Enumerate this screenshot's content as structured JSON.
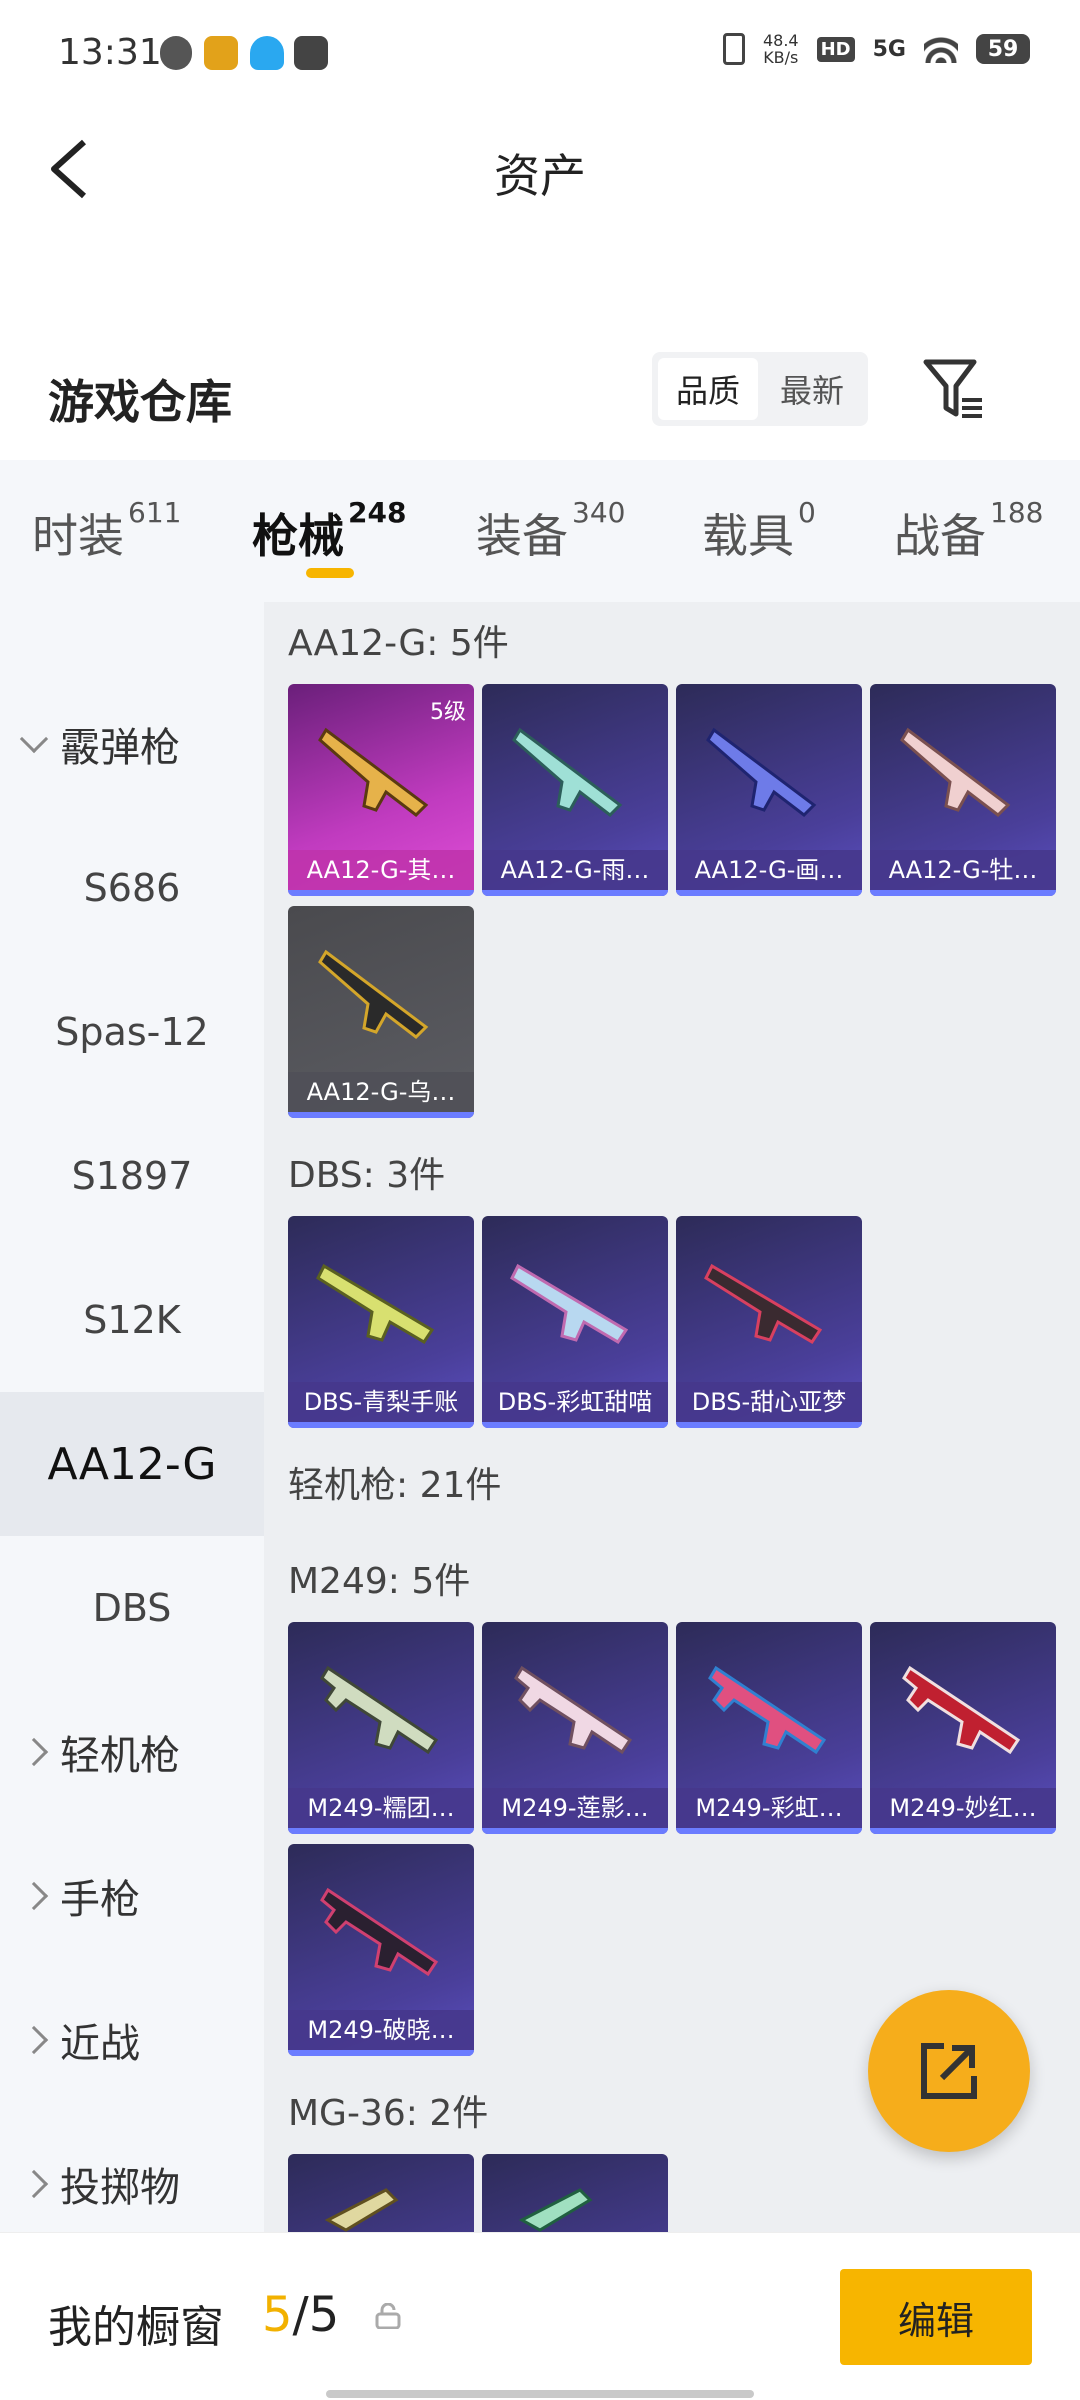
{
  "status_bar": {
    "time": "13:31",
    "net_speed_top": "48.4",
    "net_speed_unit": "KB/s",
    "hd": "HD",
    "network": "5G",
    "battery": "59"
  },
  "header": {
    "title": "资产"
  },
  "warehouse": {
    "title": "游戏仓库",
    "sort_quality": "品质",
    "sort_newest": "最新"
  },
  "tabs": [
    {
      "label": "时装",
      "count": "611"
    },
    {
      "label": "枪械",
      "count": "248"
    },
    {
      "label": "装备",
      "count": "340"
    },
    {
      "label": "载具",
      "count": "0"
    },
    {
      "label": "战备",
      "count": "188"
    }
  ],
  "sidebar": {
    "group_shotgun": "霰弹枪",
    "items": [
      "S686",
      "Spas-12",
      "S1897",
      "S12K",
      "AA12-G",
      "DBS"
    ],
    "selected": "AA12-G",
    "group_lmg": "轻机枪",
    "group_pistol": "手枪",
    "group_melee": "近战",
    "group_throw": "投掷物"
  },
  "sections": {
    "aa12": "AA12-G: 5件",
    "dbs": "DBS: 3件",
    "lmg": "轻机枪: 21件",
    "m249": "M249: 5件",
    "mg36": "MG-36: 2件"
  },
  "cards": {
    "aa12": [
      "AA12-G-其…",
      "AA12-G-雨…",
      "AA12-G-画…",
      "AA12-G-牡…",
      "AA12-G-乌…"
    ],
    "aa12_level": "5级",
    "dbs": [
      "DBS-青梨手账",
      "DBS-彩虹甜喵",
      "DBS-甜心亚梦"
    ],
    "m249": [
      "M249-糯团…",
      "M249-莲影…",
      "M249-彩虹…",
      "M249-妙红…",
      "M249-破晓…"
    ]
  },
  "bottom": {
    "title": "我的橱窗",
    "count_current": "5",
    "count_sep": "/",
    "count_total": "5",
    "edit_label": "编辑"
  },
  "colors": {
    "accent": "#f7b500",
    "card_purple": "#4a3f9a",
    "card_pink": "#c03bbf"
  }
}
